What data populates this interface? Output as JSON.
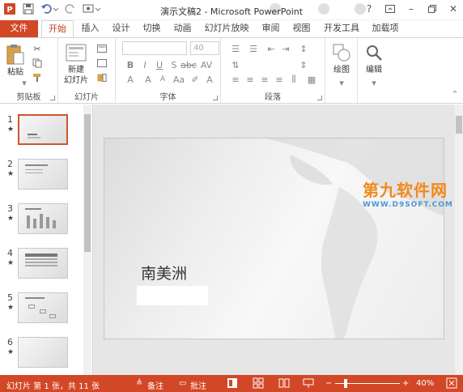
{
  "window": {
    "title": "演示文稿2 - Microsoft PowerPoint"
  },
  "tabs": [
    {
      "label": "文件"
    },
    {
      "label": "开始"
    },
    {
      "label": "插入"
    },
    {
      "label": "设计"
    },
    {
      "label": "切换"
    },
    {
      "label": "动画"
    },
    {
      "label": "幻灯片放映"
    },
    {
      "label": "审阅"
    },
    {
      "label": "视图"
    },
    {
      "label": "开发工具"
    },
    {
      "label": "加载项"
    }
  ],
  "ribbon": {
    "clipboard": {
      "paste_label": "粘贴",
      "group_label": "剪贴板"
    },
    "slides": {
      "new_slide_label_1": "新建",
      "new_slide_label_2": "幻灯片",
      "group_label": "幻灯片"
    },
    "font": {
      "size_value": "40",
      "group_label": "字体"
    },
    "paragraph": {
      "group_label": "段落"
    },
    "drawing": {
      "label": "绘图"
    },
    "editing": {
      "label": "编辑"
    }
  },
  "thumbnails": [
    {
      "number": "1",
      "star": "★",
      "selected": true
    },
    {
      "number": "2",
      "star": "★",
      "selected": false
    },
    {
      "number": "3",
      "star": "★",
      "selected": false
    },
    {
      "number": "4",
      "star": "★",
      "selected": false
    },
    {
      "number": "5",
      "star": "★",
      "selected": false
    },
    {
      "number": "6",
      "star": "★",
      "selected": false
    }
  ],
  "slide": {
    "title": "南美洲"
  },
  "watermark": {
    "main": "第九软件网",
    "sub": "WWW.D9SOFT.COM"
  },
  "statusbar": {
    "slide_info": "幻灯片 第 1 张，共 11 张",
    "notes_label": "备注",
    "comments_label": "批注",
    "zoom_value": "40%"
  },
  "colors": {
    "accent": "#d24726",
    "active_tab_text": "#c43e1c",
    "selected_thumb_border": "#c9572f"
  }
}
